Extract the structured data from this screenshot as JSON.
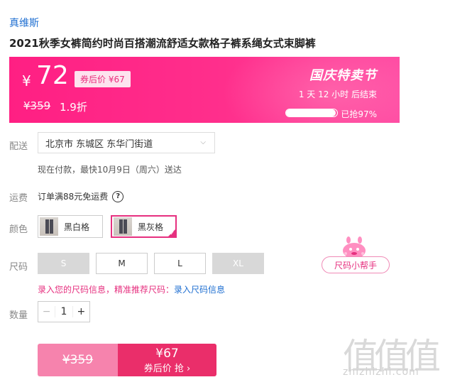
{
  "brand": "真维斯",
  "title": "2021秋季女裤简约时尚百搭潮流舒适女款格子裤系绳女式束脚裤",
  "banner": {
    "price_symbol": "¥",
    "price": "72",
    "coupon_tag": "券后价 ¥67",
    "original_price": "¥359",
    "discount": "1.9折",
    "festival": "国庆特卖节",
    "countdown": "1 天 12 小时 后结束",
    "progress_percent": 97,
    "sold_text": "已抢97%"
  },
  "delivery": {
    "label": "配送",
    "address": "北京市 东城区 东华门街道",
    "eta": "现在付款，最快10月9日（周六）送达"
  },
  "shipping": {
    "label": "运费",
    "text": "订单满88元免运费",
    "info_icon": "?"
  },
  "colors": {
    "label": "颜色",
    "options": [
      "黑白格",
      "黑灰格"
    ],
    "selected": "黑灰格"
  },
  "sizes": {
    "label": "尺码",
    "options": [
      "S",
      "M",
      "L",
      "XL"
    ],
    "disabled": [
      "S",
      "XL"
    ],
    "helper": "尺码小帮手",
    "tip_prefix": "录入您的尺码信息，精准推荐尺码：",
    "tip_link": "录入尺码信息"
  },
  "quantity": {
    "label": "数量",
    "value": "1",
    "minus": "−",
    "plus": "+"
  },
  "buy": {
    "original": "¥359",
    "coupon_price": "¥67",
    "coupon_text": "券后价 抢 ›"
  },
  "watermark": {
    "logo": "值值值",
    "url": "zhizhizhi.com"
  },
  "colors_theme": {
    "accent": "#e6307f",
    "banner": "#ff2f8c",
    "link": "#1f6fd1"
  }
}
